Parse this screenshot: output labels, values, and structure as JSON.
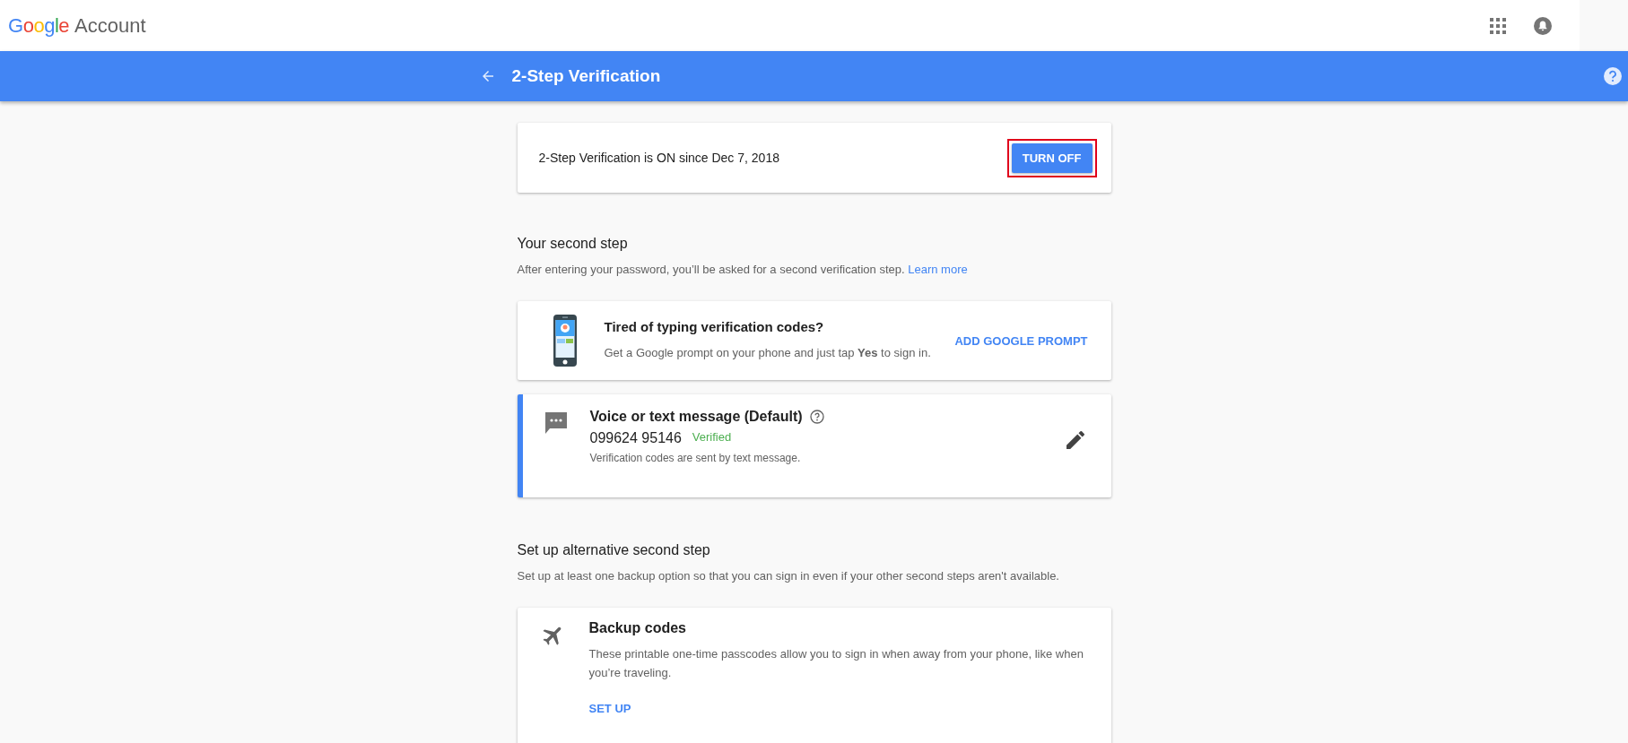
{
  "header": {
    "logo": "Google",
    "product": "Account"
  },
  "title_bar": {
    "title": "2-Step Verification"
  },
  "status": {
    "text": "2-Step Verification is ON since Dec 7, 2018",
    "button": "TURN OFF",
    "highlighted": true
  },
  "sections": [
    {
      "heading": "Your second step",
      "description": "After entering your password, you’ll be asked for a second verification step.",
      "link": "Learn more",
      "cards": [
        {
          "kind": "promo",
          "title": "Tired of typing verification codes?",
          "text": "Get a Google prompt on your phone and just tap **Yes** to sign in.",
          "action": "ADD GOOGLE PROMPT"
        },
        {
          "kind": "method",
          "default": true,
          "title": "Voice or text message (Default)",
          "phone": "099624 95146",
          "status": "Verified",
          "text": "Verification codes are sent by text message."
        }
      ]
    },
    {
      "heading": "Set up alternative second step",
      "description": "Set up at least one backup option so that you can sign in even if your other second steps aren't available.",
      "cards": [
        {
          "kind": "backup",
          "title": "Backup codes",
          "text": "These printable one-time passcodes allow you to sign in when away from your phone, like when you’re traveling.",
          "action": "SET UP"
        }
      ]
    }
  ]
}
